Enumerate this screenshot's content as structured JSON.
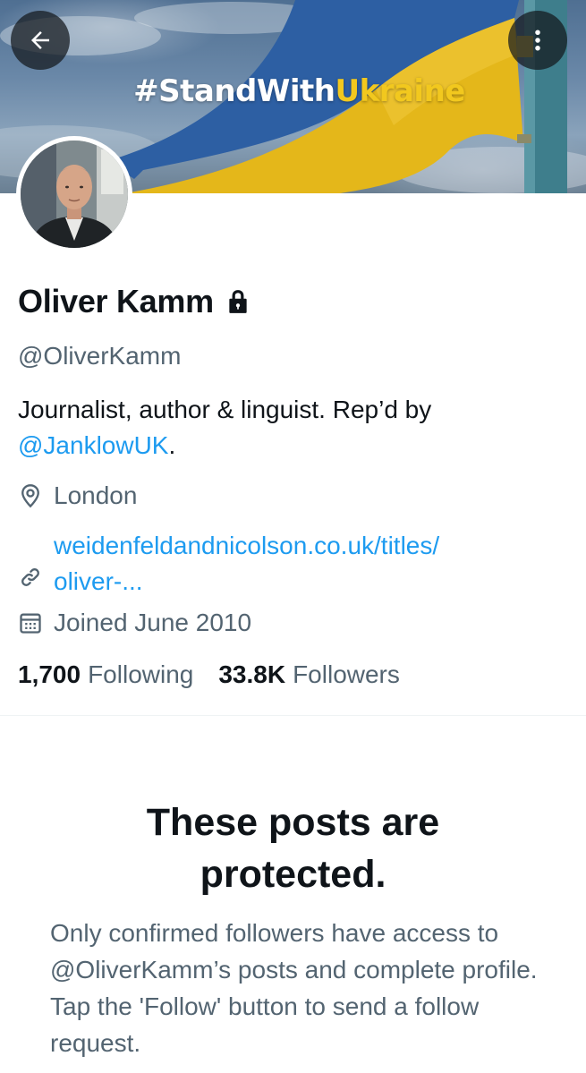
{
  "banner": {
    "title_prefix": "#StandWith",
    "title_highlight": "Ukraine",
    "back_icon": "arrow-left-icon",
    "more_icon": "more-vertical-icon",
    "highlight_color": "#f2c81e"
  },
  "profile": {
    "name": "Oliver Kamm",
    "lock_icon": "lock-icon",
    "handle": "@OliverKamm",
    "bio_text": "Journalist, author & linguist. Rep’d by",
    "bio_mention": "@JanklowUK",
    "bio_suffix": ".",
    "location": "London",
    "website_line1": "weidenfeldandnicolson.co.uk/titles/",
    "website_line2": "oliver-...",
    "joined": "Joined June 2010",
    "following_count": "1,700",
    "following_label": "Following",
    "followers_count": "33.8K",
    "followers_label": "Followers"
  },
  "protected": {
    "title_line1": "These posts are",
    "title_line2": "protected.",
    "description": "Only confirmed followers have access to @OliverKamm’s posts and complete profile. Tap the 'Follow' button to send a follow request."
  },
  "colors": {
    "link": "#1d9bf0",
    "secondary_text": "#536471",
    "primary_text": "#0f1419"
  }
}
